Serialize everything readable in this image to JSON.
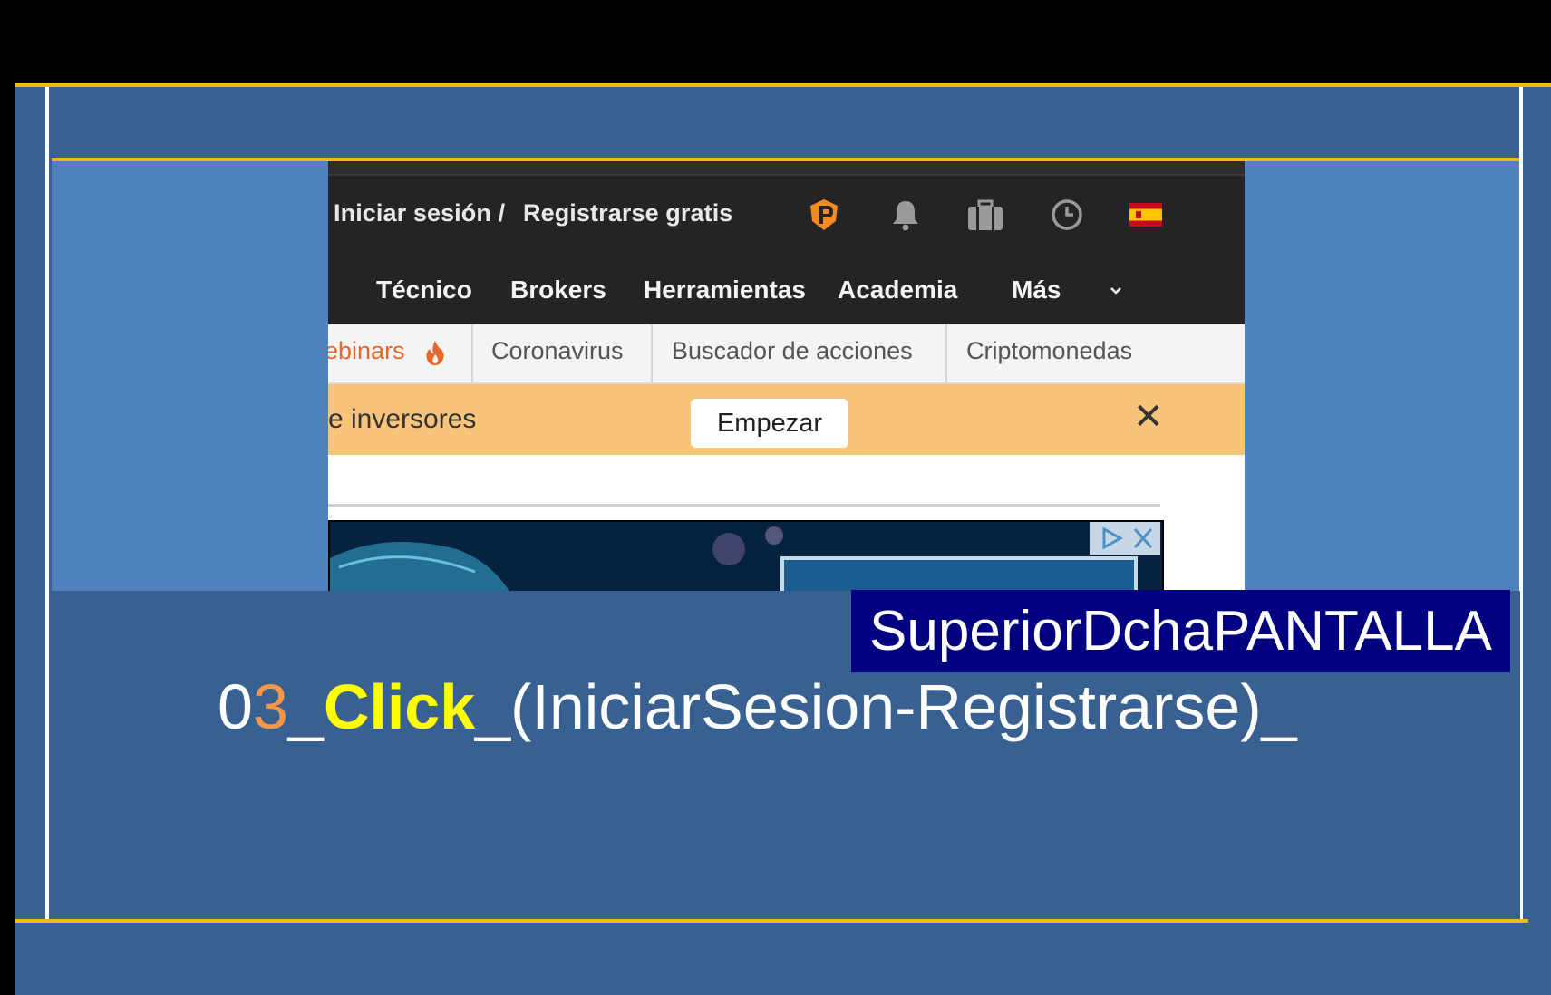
{
  "screenshot": {
    "auth": {
      "login_label": "Iniciar sesión /",
      "register_label": "Registrarse gratis"
    },
    "icons": [
      "investing-pro-icon",
      "bell-icon",
      "briefcase-icon",
      "clock-icon",
      "spain-flag-icon"
    ],
    "nav": {
      "items": [
        "Técnico",
        "Brokers",
        "Herramientas",
        "Academia",
        "Más"
      ]
    },
    "subnav": {
      "items": [
        "ebinars",
        "Coronavirus",
        "Buscador de acciones",
        "Criptomonedas"
      ]
    },
    "promo": {
      "text": "e inversores",
      "button_label": "Empezar",
      "close_label": "✕"
    }
  },
  "annotation": {
    "position_label": "SuperiorDchaPANTALLA",
    "step_prefix_0": "0",
    "step_prefix_num": "3",
    "step_sep_1": "_",
    "step_action": "Click",
    "step_rest": "_(IniciarSesion-Registrarse)_"
  },
  "colors": {
    "slide_blue": "#386192",
    "panel_blue": "#4f81bd",
    "rule_gold": "#f6b817",
    "label_navy": "#000080",
    "accent_orange": "#f79646",
    "accent_yellow": "#ffff00",
    "promo_orange": "#f7c479",
    "webinars_orange": "#e8652b"
  }
}
